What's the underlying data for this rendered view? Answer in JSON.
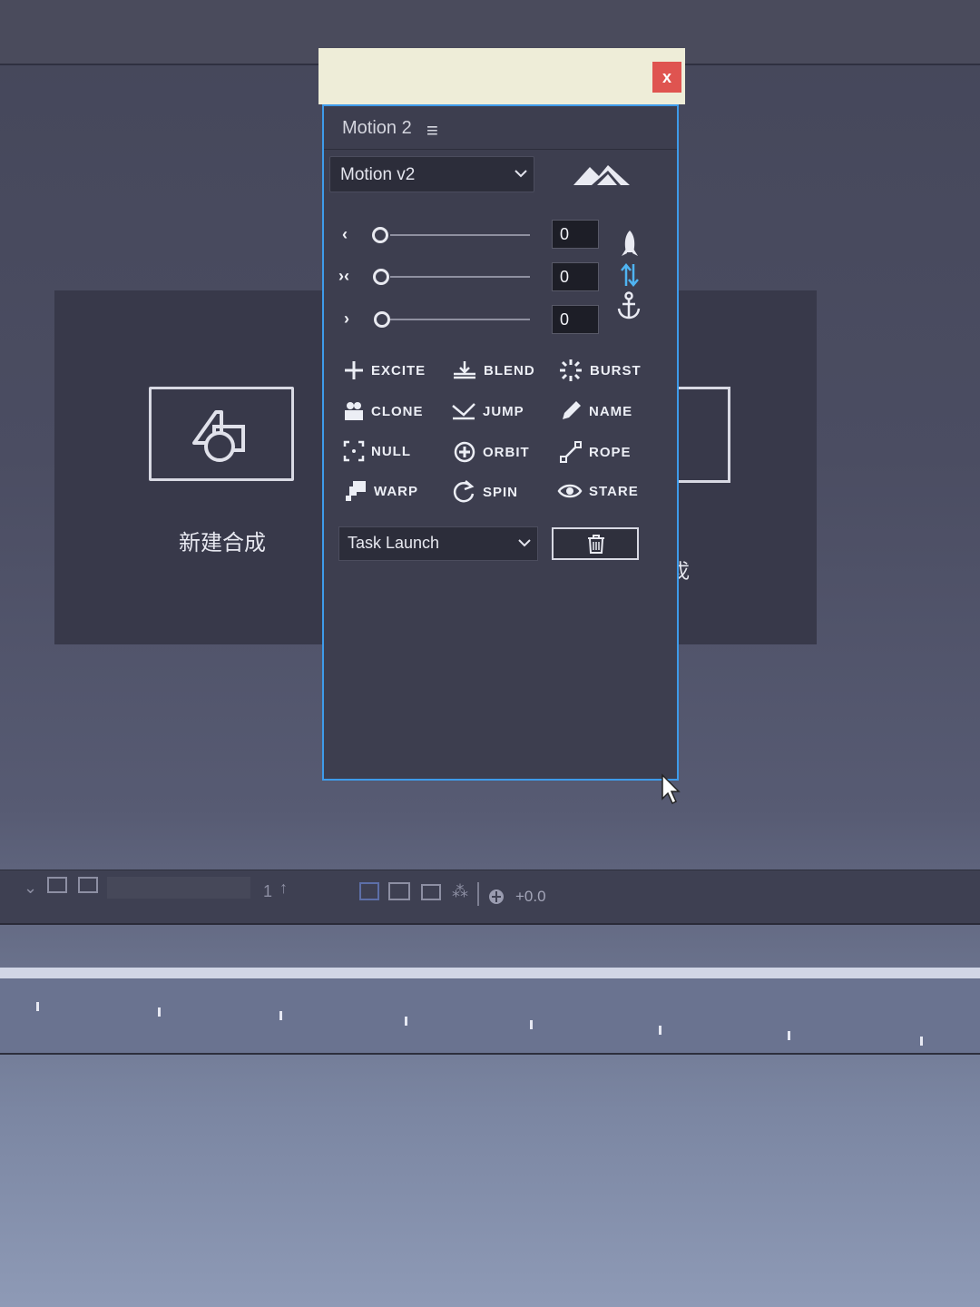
{
  "background": {
    "home_tile_label": "新建合成",
    "home_tile2_label": "戉"
  },
  "panel": {
    "close_label": "x",
    "title": "Motion 2",
    "menu_icon": "≡",
    "preset_select": "Motion v2",
    "sliders": [
      {
        "arrow": "‹",
        "value": "0"
      },
      {
        "arrow": "›‹",
        "value": "0"
      },
      {
        "arrow": "›",
        "value": "0"
      }
    ],
    "side_icons": [
      "rocket-icon",
      "swap-vertical-icon",
      "anchor-icon"
    ],
    "tools": [
      {
        "label": "EXCITE",
        "icon": "plus-icon"
      },
      {
        "label": "BLEND",
        "icon": "blend-icon"
      },
      {
        "label": "BURST",
        "icon": "burst-icon"
      },
      {
        "label": "CLONE",
        "icon": "clone-icon"
      },
      {
        "label": "JUMP",
        "icon": "jump-icon"
      },
      {
        "label": "NAME",
        "icon": "pencil-icon"
      },
      {
        "label": "NULL",
        "icon": "null-icon"
      },
      {
        "label": "ORBIT",
        "icon": "orbit-icon"
      },
      {
        "label": "ROPE",
        "icon": "rope-icon"
      },
      {
        "label": "WARP",
        "icon": "warp-icon"
      },
      {
        "label": "SPIN",
        "icon": "spin-icon"
      },
      {
        "label": "STARE",
        "icon": "eye-icon"
      }
    ],
    "task_select": "Task Launch",
    "trash_icon": "trash-icon"
  },
  "toolbar": {
    "value": "+0.0",
    "count": "1"
  },
  "colors": {
    "panel_border": "#3e9bea",
    "close_button": "#df5450",
    "titlebar": "#eeedd8",
    "panel_bg": "#3d3e4f"
  }
}
